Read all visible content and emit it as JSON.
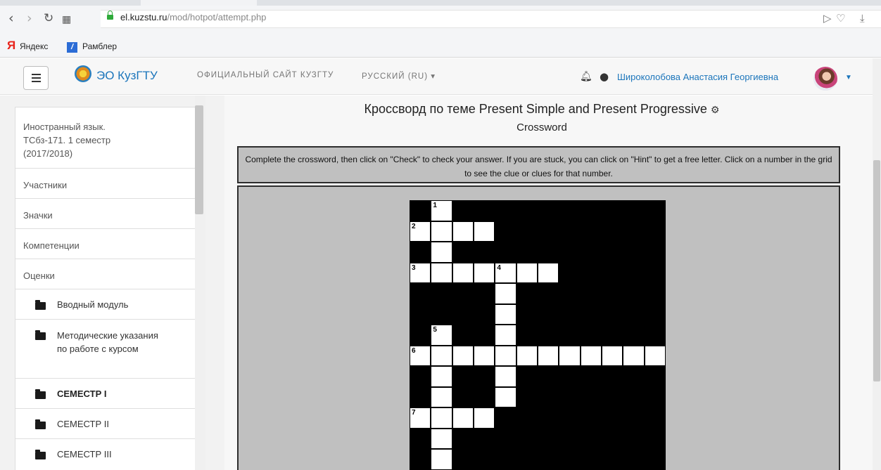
{
  "browser": {
    "url_domain": "el.kuzstu.ru",
    "url_path": "/mod/hotpot/attempt.php",
    "bookmarks": [
      "Яндекс",
      "Рамблер"
    ]
  },
  "navbar": {
    "site_name": "ЭО КузГТУ",
    "official_link": "ОФИЦИАЛЬНЫЙ САЙТ КУЗГТУ",
    "language": "РУССКИЙ (RU)",
    "user_name": "Широколобова Анастасия Георгиевна"
  },
  "sidebar": {
    "course": "Иностранный язык. ТСбз-171. 1 семестр (2017/2018)",
    "items": [
      "Участники",
      "Значки",
      "Компетенции",
      "Оценки"
    ],
    "folders": [
      "Вводный модуль",
      "Методические указания по работе с курсом",
      "СЕМЕСТР I",
      "СЕМЕСТР II",
      "СЕМЕСТР III"
    ]
  },
  "main": {
    "title": "Кроссворд по теме Present Simple and Present Progressive",
    "subtitle": "Crossword",
    "instructions": "Complete the crossword, then click on \"Check\" to check your answer. If you are stuck, you can click on \"Hint\" to get a free letter. Click on a number in the grid to see the clue or clues for that number."
  },
  "crossword": {
    "rows": 13,
    "cols": 12,
    "white_cells": [
      [
        0,
        1
      ],
      [
        1,
        0
      ],
      [
        1,
        1
      ],
      [
        1,
        2
      ],
      [
        1,
        3
      ],
      [
        2,
        1
      ],
      [
        3,
        0
      ],
      [
        3,
        1
      ],
      [
        3,
        2
      ],
      [
        3,
        3
      ],
      [
        3,
        4
      ],
      [
        3,
        5
      ],
      [
        3,
        6
      ],
      [
        4,
        4
      ],
      [
        5,
        4
      ],
      [
        6,
        1
      ],
      [
        6,
        4
      ],
      [
        7,
        0
      ],
      [
        7,
        1
      ],
      [
        7,
        2
      ],
      [
        7,
        3
      ],
      [
        7,
        4
      ],
      [
        7,
        5
      ],
      [
        7,
        6
      ],
      [
        7,
        7
      ],
      [
        7,
        8
      ],
      [
        7,
        9
      ],
      [
        7,
        10
      ],
      [
        7,
        11
      ],
      [
        8,
        1
      ],
      [
        8,
        4
      ],
      [
        9,
        1
      ],
      [
        9,
        4
      ],
      [
        10,
        0
      ],
      [
        10,
        1
      ],
      [
        10,
        2
      ],
      [
        10,
        3
      ],
      [
        11,
        1
      ],
      [
        12,
        1
      ]
    ],
    "numbers": [
      {
        "r": 0,
        "c": 1,
        "n": "1"
      },
      {
        "r": 1,
        "c": 0,
        "n": "2"
      },
      {
        "r": 3,
        "c": 0,
        "n": "3"
      },
      {
        "r": 3,
        "c": 4,
        "n": "4"
      },
      {
        "r": 6,
        "c": 1,
        "n": "5"
      },
      {
        "r": 7,
        "c": 0,
        "n": "6"
      },
      {
        "r": 10,
        "c": 0,
        "n": "7"
      }
    ]
  }
}
